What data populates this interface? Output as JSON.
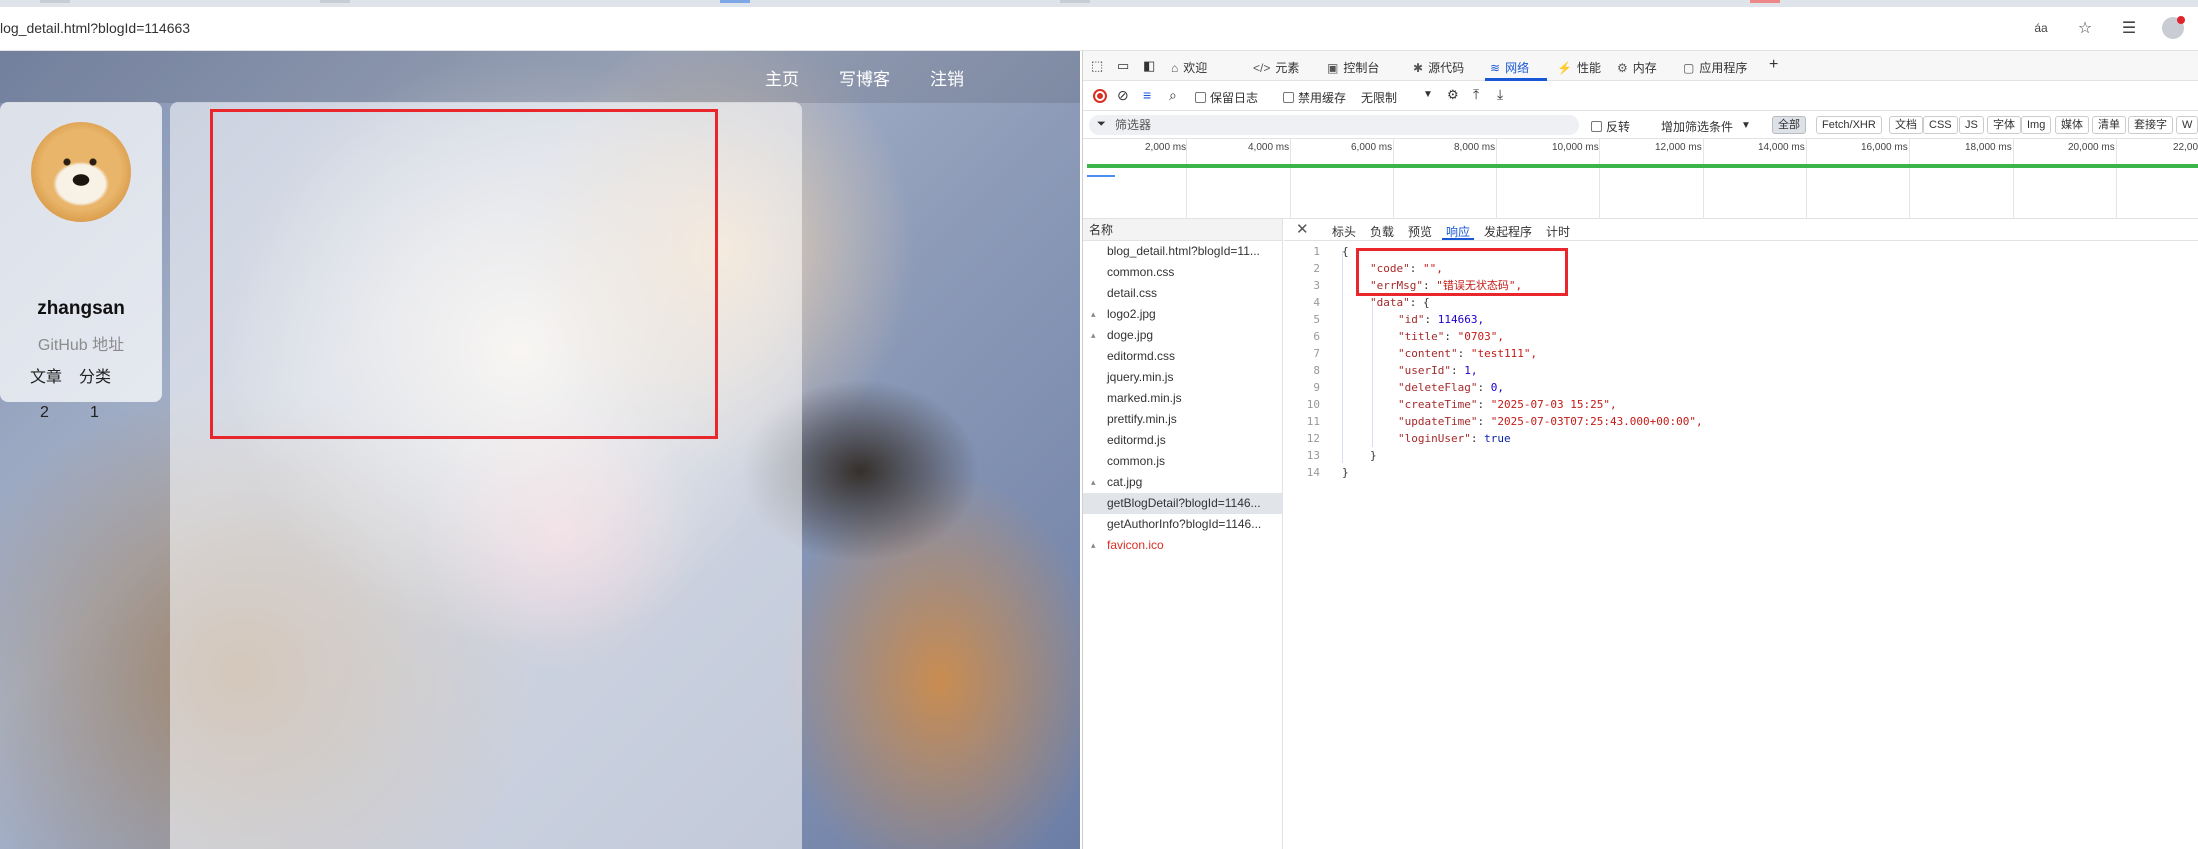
{
  "browser": {
    "url": "log_detail.html?blogId=114663",
    "read_aloud_label": "áa"
  },
  "blog": {
    "nav": [
      "主页",
      "写博客",
      "注销"
    ],
    "author": {
      "username": "zhangsan",
      "github_label": "GitHub 地址",
      "stat_labels": [
        "文章",
        "分类"
      ],
      "stat_values": [
        "2",
        "1"
      ]
    }
  },
  "devtools": {
    "tabs": [
      {
        "icon": "⌂",
        "label": "欢迎"
      },
      {
        "icon": "</>",
        "label": "元素"
      },
      {
        "icon": "▣",
        "label": "控制台"
      },
      {
        "icon": "✱",
        "label": "源代码"
      },
      {
        "icon": "≋",
        "label": "网络"
      },
      {
        "icon": "⚡",
        "label": "性能"
      },
      {
        "icon": "⚙",
        "label": "内存"
      },
      {
        "icon": "▢",
        "label": "应用程序"
      }
    ],
    "active_tab": "网络",
    "toolbar": {
      "preserve_log": "保留日志",
      "disable_cache": "禁用缓存",
      "throttle": "无限制"
    },
    "filter": {
      "placeholder": "筛选器",
      "invert": "反转",
      "more_filters": "增加筛选条件",
      "chips": [
        "全部",
        "Fetch/XHR",
        "文档",
        "CSS",
        "JS",
        "字体",
        "Img",
        "媒体",
        "清单",
        "套接字",
        "W"
      ]
    },
    "timeline_ticks": [
      "2,000 ms",
      "4,000 ms",
      "6,000 ms",
      "8,000 ms",
      "10,000 ms",
      "12,000 ms",
      "14,000 ms",
      "16,000 ms",
      "18,000 ms",
      "20,000 ms",
      "22,00"
    ],
    "request_header": "名称",
    "requests": [
      {
        "name": "blog_detail.html?blogId=11...",
        "type": "doc",
        "error": false,
        "selected": false
      },
      {
        "name": "common.css",
        "type": "css",
        "error": false,
        "selected": false
      },
      {
        "name": "detail.css",
        "type": "css",
        "error": false,
        "selected": false
      },
      {
        "name": "logo2.jpg",
        "type": "img",
        "error": false,
        "selected": false
      },
      {
        "name": "doge.jpg",
        "type": "img",
        "error": false,
        "selected": false
      },
      {
        "name": "editormd.css",
        "type": "css",
        "error": false,
        "selected": false
      },
      {
        "name": "jquery.min.js",
        "type": "js",
        "error": false,
        "selected": false
      },
      {
        "name": "marked.min.js",
        "type": "js",
        "error": false,
        "selected": false
      },
      {
        "name": "prettify.min.js",
        "type": "js",
        "error": false,
        "selected": false
      },
      {
        "name": "editormd.js",
        "type": "js",
        "error": false,
        "selected": false
      },
      {
        "name": "common.js",
        "type": "js",
        "error": false,
        "selected": false
      },
      {
        "name": "cat.jpg",
        "type": "img",
        "error": false,
        "selected": false
      },
      {
        "name": "getBlogDetail?blogId=1146...",
        "type": "xhr",
        "error": false,
        "selected": true
      },
      {
        "name": "getAuthorInfo?blogId=1146...",
        "type": "xhr",
        "error": false,
        "selected": false
      },
      {
        "name": "favicon.ico",
        "type": "img",
        "error": true,
        "selected": false
      }
    ],
    "detail_tabs": [
      "标头",
      "负载",
      "预览",
      "响应",
      "发起程序",
      "计时"
    ],
    "active_detail_tab": "响应",
    "response_lines": [
      {
        "n": "1",
        "text": "{"
      },
      {
        "n": "2",
        "text": "\"code\": \"\","
      },
      {
        "n": "3",
        "text": "\"errMsg\": \"错误无状态码\","
      },
      {
        "n": "4",
        "text": "\"data\": {"
      },
      {
        "n": "5",
        "text": "\"id\": 114663,"
      },
      {
        "n": "6",
        "text": "\"title\": \"0703\","
      },
      {
        "n": "7",
        "text": "\"content\": \"test111\","
      },
      {
        "n": "8",
        "text": "\"userId\": 1,"
      },
      {
        "n": "9",
        "text": "\"deleteFlag\": 0,"
      },
      {
        "n": "10",
        "text": "\"createTime\": \"2025-07-03 15:25\","
      },
      {
        "n": "11",
        "text": "\"updateTime\": \"2025-07-03T07:25:43.000+00:00\","
      },
      {
        "n": "12",
        "text": "\"loginUser\": true"
      },
      {
        "n": "13",
        "text": "}"
      },
      {
        "n": "14",
        "text": "}"
      }
    ]
  },
  "colors": {
    "highlight_red": "#e8262c",
    "devtools_blue": "#1a57d6"
  }
}
